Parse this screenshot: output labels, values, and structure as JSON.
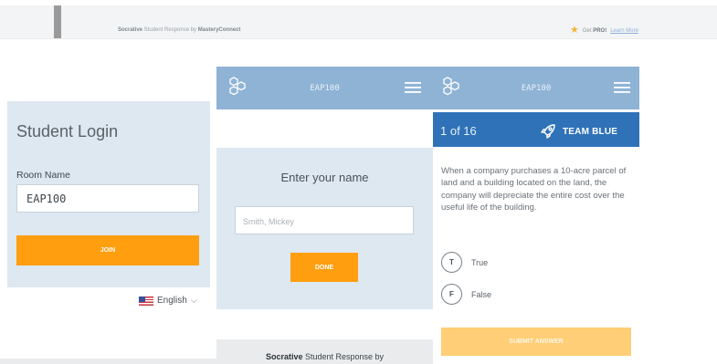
{
  "topbar": {
    "brand_bold": "Socrative",
    "brand_rest": " Student Response by ",
    "brand_org": "MasteryConnect",
    "pro_label": "Get ",
    "pro_bold": "PRO!",
    "learn_more": "Learn More"
  },
  "login": {
    "title": "Student Login",
    "room_label": "Room Name",
    "room_value": "EAP100",
    "join_label": "JOIN",
    "language": "English"
  },
  "name_screen": {
    "room": "EAP100",
    "prompt": "Enter your name",
    "name_placeholder": "Smith, Mickey",
    "done_label": "DONE",
    "footer_bold": "Socrative",
    "footer_rest": " Student Response by"
  },
  "question_screen": {
    "room": "EAP100",
    "progress": "1 of 16",
    "team": "TEAM BLUE",
    "question": "When a company purchases a 10-acre parcel of land and a building located on the land, the company will depreciate the entire cost over the useful life of the building.",
    "options": [
      {
        "letter": "T",
        "text": "True"
      },
      {
        "letter": "F",
        "text": "False"
      }
    ],
    "submit_label": "SUBMIT ANSWER"
  },
  "colors": {
    "header_blue": "#8fb3d5",
    "team_bar": "#2f72b7",
    "card_bg": "#dde8f1",
    "accent_orange": "#ff9e0f",
    "submit_disabled": "#ffce76"
  },
  "icons": [
    "socrative-logo-icon",
    "hamburger-menu-icon",
    "rocket-icon",
    "star-icon",
    "us-flag-icon",
    "chevron-down-icon"
  ]
}
